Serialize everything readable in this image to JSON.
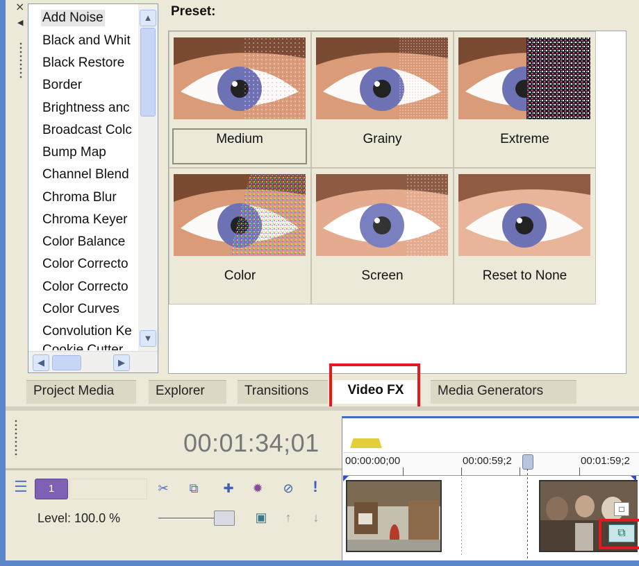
{
  "fx_list": {
    "items": [
      "Add Noise",
      "Black and Whit",
      "Black Restore",
      "Border",
      "Brightness anc",
      "Broadcast Colc",
      "Bump Map",
      "Channel Blend",
      "Chroma Blur",
      "Chroma Keyer",
      "Color Balance",
      "Color Correcto",
      "Color Correcto",
      "Color Curves",
      "Convolution Ke"
    ],
    "selected": "Add Noise"
  },
  "preset": {
    "label": "Preset:",
    "items": [
      {
        "name": "Medium",
        "noise": "medium-noise"
      },
      {
        "name": "Grainy",
        "noise": "grainy-noise"
      },
      {
        "name": "Extreme",
        "noise": "extreme-noise"
      },
      {
        "name": "Color",
        "noise": "color-noise"
      },
      {
        "name": "Screen",
        "noise": "screen-noise"
      },
      {
        "name": "Reset to None",
        "noise": "none"
      }
    ],
    "selected": "Medium"
  },
  "tabs": [
    "Project Media",
    "Explorer",
    "Transitions",
    "Video FX",
    "Media Generators"
  ],
  "active_tab": "Video FX",
  "timeline": {
    "timecode": "00:01:34;01",
    "ruler": [
      "00:00:00;00",
      "00:00:59;2",
      "00:01:59;2"
    ],
    "track_number": "1",
    "level_label": "Level: 100.0 %",
    "level_value": 100.0
  },
  "colors": {
    "highlight": "#e2191f",
    "track_badge": "#7e61b5",
    "window_bg": "#ece9d8",
    "desktop": "#5b87c9"
  },
  "icons": [
    "close-icon",
    "collapse-arrow-icon",
    "scroll-up-icon",
    "scroll-down-icon",
    "scroll-left-icon",
    "scroll-right-icon",
    "track-motion-icon",
    "event-pan-crop-icon",
    "composite-icon",
    "track-fx-icon",
    "mute-icon",
    "solo-icon",
    "compositing-mode-icon",
    "make-parent-icon",
    "make-child-icon",
    "minimize-track-icon",
    "event-fx-icon",
    "event-fx-sub-icon"
  ]
}
